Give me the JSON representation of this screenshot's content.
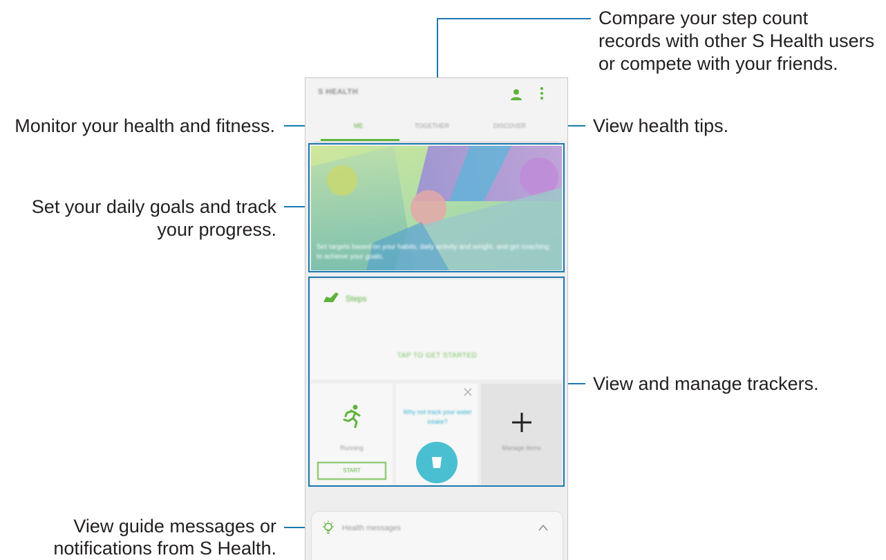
{
  "callouts": {
    "compare": [
      "Compare your step count",
      "records with other S Health users",
      "or compete with your friends."
    ],
    "monitor": "Monitor your health and fitness.",
    "tips": "View health tips.",
    "goals": [
      "Set your daily goals and track",
      "your progress."
    ],
    "trackers": "View and manage trackers.",
    "guide": [
      "View guide messages or",
      "notifications from S Health."
    ]
  },
  "app": {
    "title": "S HEALTH",
    "tabs": [
      {
        "label": "Me",
        "active": true
      },
      {
        "label": "Together",
        "active": false
      },
      {
        "label": "Discover",
        "active": false
      }
    ],
    "hero_text": "Set targets based on your habits, daily activity and weight, and get coaching to achieve your goals.",
    "steps": {
      "label": "Steps",
      "prompt": "TAP TO GET STARTED"
    },
    "trackers": {
      "running_label": "Running",
      "start_button": "START",
      "water_prompt": "Why not track your water intake?",
      "manage_label": "Manage items"
    },
    "messages_label": "Health messages"
  },
  "colors": {
    "accent_green": "#5eb33b",
    "water_blue": "#4bbfd2",
    "callout_line": "#1a78b0"
  },
  "icons": [
    "profile-icon",
    "more-vertical-icon",
    "shoe-icon",
    "running-icon",
    "close-icon",
    "cup-icon",
    "plus-icon",
    "lightbulb-icon",
    "chevron-up-icon"
  ]
}
